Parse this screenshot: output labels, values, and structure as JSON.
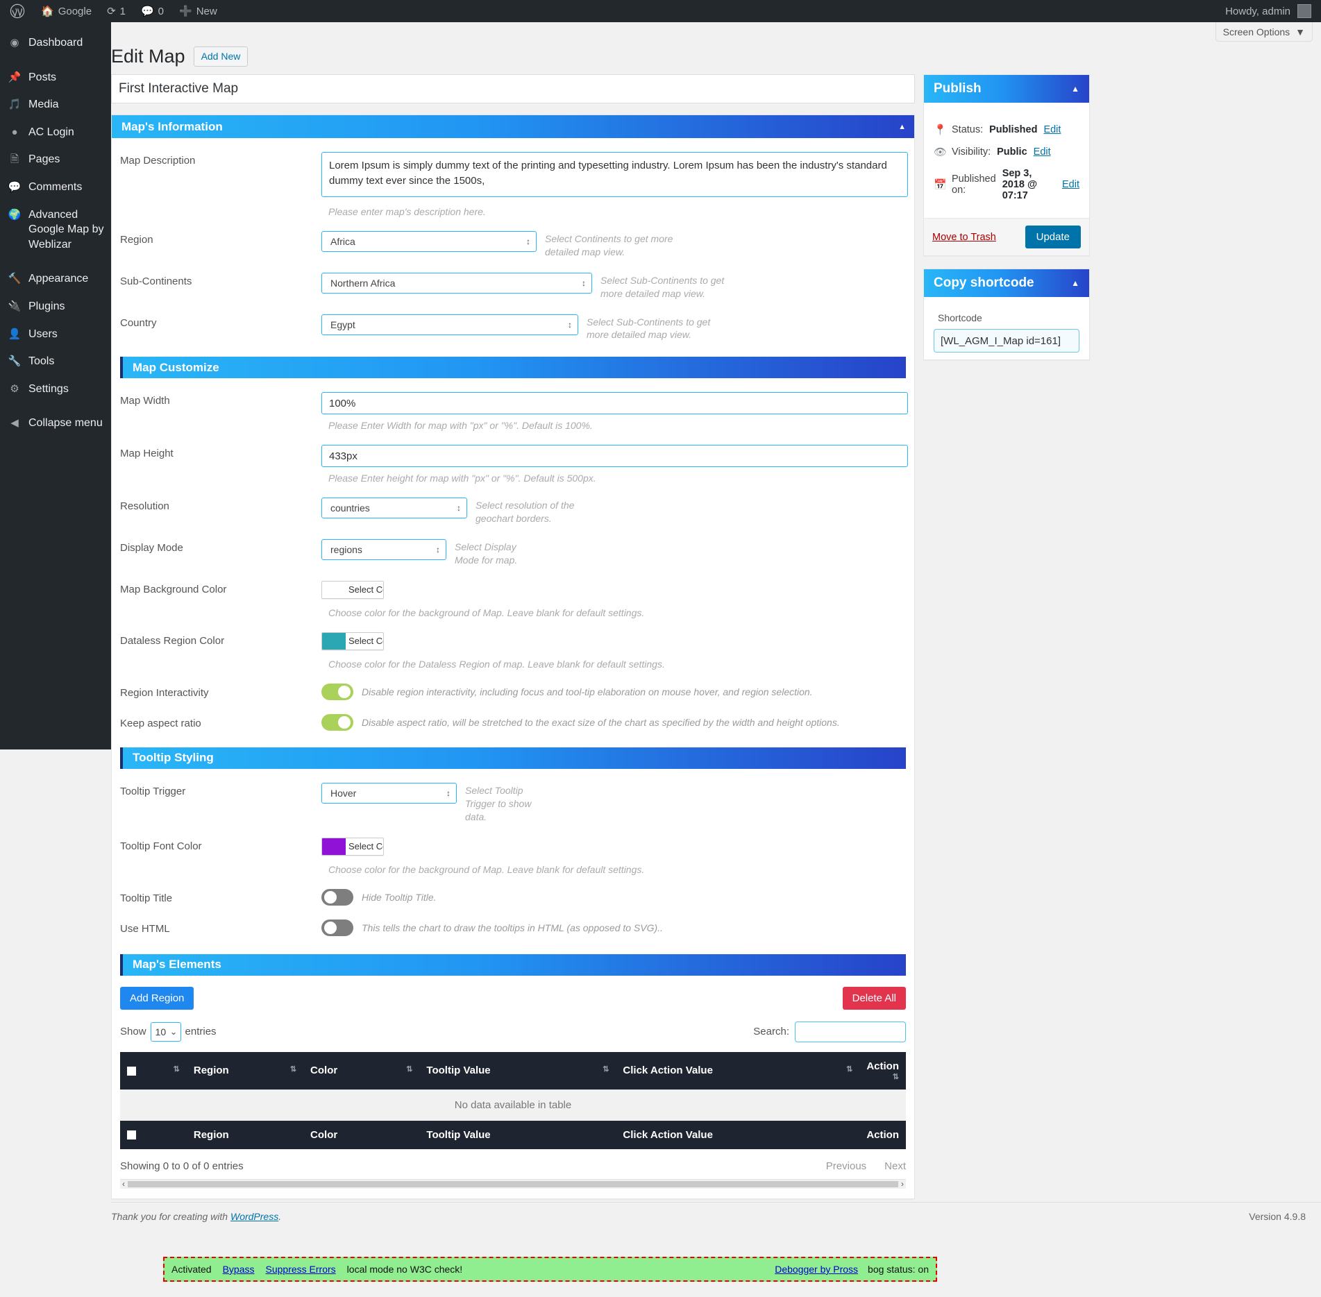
{
  "adminbar": {
    "logo_icon": "wordpress-logo-icon",
    "site_name": "Google",
    "updates_icon": "updates-icon",
    "updates_count": "1",
    "comments_icon": "comments-icon",
    "comments_count": "0",
    "new_icon": "plus-icon",
    "new_label": "New",
    "howdy": "Howdy, admin"
  },
  "sidebar": {
    "items": [
      {
        "label": "Dashboard",
        "icon": "dashboard-icon"
      },
      {
        "label": "Posts",
        "icon": "pin-icon"
      },
      {
        "label": "Media",
        "icon": "media-icon"
      },
      {
        "label": "AC Login",
        "icon": "ac-login-icon"
      },
      {
        "label": "Pages",
        "icon": "pages-icon"
      },
      {
        "label": "Comments",
        "icon": "comments-icon"
      },
      {
        "label": "Advanced Google Map by Weblizar",
        "icon": "globe-icon"
      },
      {
        "label": "Appearance",
        "icon": "appearance-icon"
      },
      {
        "label": "Plugins",
        "icon": "plugin-icon"
      },
      {
        "label": "Users",
        "icon": "users-icon"
      },
      {
        "label": "Tools",
        "icon": "tools-icon"
      },
      {
        "label": "Settings",
        "icon": "settings-icon"
      },
      {
        "label": "Collapse menu",
        "icon": "collapse-icon"
      }
    ]
  },
  "header": {
    "screen_options": "Screen Options",
    "page_title": "Edit Map",
    "add_new": "Add New"
  },
  "post": {
    "title": "First Interactive Map"
  },
  "map_information": {
    "heading": "Map's Information",
    "description_label": "Map Description",
    "description_value": "Lorem Ipsum is simply dummy text of the printing and typesetting industry. Lorem Ipsum has been the industry's standard dummy text ever since the 1500s,",
    "description_hint": "Please enter map's description here.",
    "region_label": "Region",
    "region_value": "Africa",
    "region_hint": "Select Continents to get more detailed map view.",
    "subcontinents_label": "Sub-Continents",
    "subcontinents_value": "Northern Africa",
    "subcontinents_hint": "Select Sub-Continents to get more detailed map view.",
    "country_label": "Country",
    "country_value": "Egypt",
    "country_hint": "Select Sub-Continents to get more detailed map view."
  },
  "map_customize": {
    "heading": "Map Customize",
    "width_label": "Map Width",
    "width_value": "100%",
    "width_hint": "Please Enter Width for map with \"px\" or \"%\". Default is 100%.",
    "height_label": "Map Height",
    "height_value": "433px",
    "height_hint": "Please Enter height for map with \"px\" or \"%\". Default is 500px.",
    "resolution_label": "Resolution",
    "resolution_value": "countries",
    "resolution_hint": "Select resolution of the geochart borders.",
    "display_mode_label": "Display Mode",
    "display_mode_value": "regions",
    "display_mode_hint": "Select Display Mode for map.",
    "bg_color_label": "Map Background Color",
    "bg_color_button": "Select Color",
    "bg_color_value": "#ffffff",
    "bg_color_hint": "Choose color for the background of Map. Leave blank for default settings.",
    "dataless_label": "Dataless Region Color",
    "dataless_button": "Select Color",
    "dataless_value": "#2ba6b3",
    "dataless_hint": "Choose color for the Dataless Region of map. Leave blank for default settings.",
    "interactivity_label": "Region Interactivity",
    "interactivity_state": "on",
    "interactivity_text": "Disable region interactivity, including focus and tool-tip elaboration on mouse hover, and region selection.",
    "aspect_label": "Keep aspect ratio",
    "aspect_state": "on",
    "aspect_text": "Disable aspect ratio, will be stretched to the exact size of the chart as specified by the width and height options."
  },
  "tooltip_styling": {
    "heading": "Tooltip Styling",
    "trigger_label": "Tooltip Trigger",
    "trigger_value": "Hover",
    "trigger_hint": "Select Tooltip Trigger to show data.",
    "font_color_label": "Tooltip Font Color",
    "font_color_button": "Select Color",
    "font_color_value": "#8f12d6",
    "font_color_hint": "Choose color for the background of Map. Leave blank for default settings.",
    "title_label": "Tooltip Title",
    "title_state": "off",
    "title_text": "Hide Tooltip Title.",
    "html_label": "Use HTML",
    "html_state": "off",
    "html_text": "This tells the chart to draw the tooltips in HTML (as opposed to SVG).."
  },
  "map_elements": {
    "heading": "Map's Elements",
    "add_region": "Add Region",
    "delete_all": "Delete All",
    "show_label": "Show",
    "entries_label": "entries",
    "page_length": "10",
    "search_label": "Search:",
    "search_value": "",
    "columns": [
      "",
      "Region",
      "Color",
      "Tooltip Value",
      "Click Action Value",
      "Action"
    ],
    "empty_message": "No data available in table",
    "info": "Showing 0 to 0 of 0 entries",
    "previous": "Previous",
    "next": "Next"
  },
  "publish": {
    "heading": "Publish",
    "status_prefix": "Status:",
    "status_value": "Published",
    "status_edit": "Edit",
    "visibility_prefix": "Visibility:",
    "visibility_value": "Public",
    "visibility_edit": "Edit",
    "published_prefix": "Published on:",
    "published_value": "Sep 3, 2018 @ 07:17",
    "published_edit": "Edit",
    "trash": "Move to Trash",
    "update": "Update"
  },
  "shortcode": {
    "heading": "Copy shortcode",
    "label": "Shortcode",
    "value": "[WL_AGM_I_Map id=161]"
  },
  "footer": {
    "thanks_prefix": "Thank you for creating with",
    "thanks_link": "WordPress",
    "thanks_suffix": ".",
    "version": "Version 4.9.8"
  },
  "debugbar": {
    "activated": "Activated",
    "bypass": "Bypass",
    "suppress": "Suppress Errors",
    "mode": "local mode no W3C check!",
    "debogger": "Debogger by Pross",
    "status": "bog status: on"
  },
  "colors": {
    "admin_bg": "#23282d",
    "accent_blue": "#2196f3",
    "gradient_end": "#2743c9",
    "toggle_on": "#aad159",
    "toggle_off": "#7e7e7e",
    "danger": "#e3344e",
    "primary_button": "#1e87f0"
  }
}
